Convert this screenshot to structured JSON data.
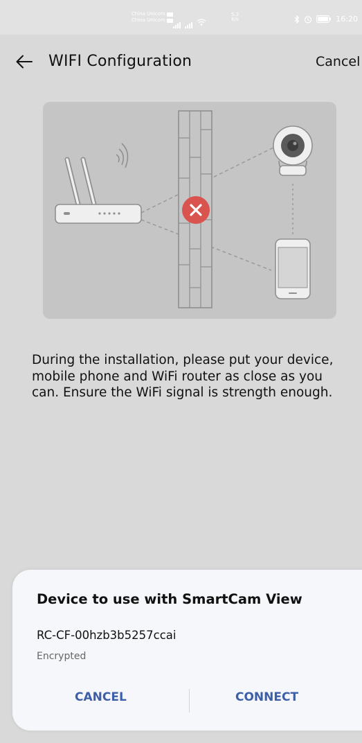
{
  "status_bar": {
    "carrier_1": "China Unicom",
    "carrier_2": "China Unicom",
    "net_speed_value": "5.3",
    "net_speed_unit": "K/s",
    "time": "16:20",
    "icons": [
      "signal-icon",
      "wifi-icon",
      "bluetooth-icon",
      "alarm-icon",
      "battery-icon"
    ]
  },
  "header": {
    "title": "WIFI Configuration",
    "cancel_label": "Cancel",
    "back_icon": "arrow-left-icon"
  },
  "illustration": {
    "icons": [
      "router-icon",
      "brick-wall-icon",
      "blocked-x-icon",
      "camera-icon",
      "phone-icon"
    ],
    "blocked_color": "#d9534f"
  },
  "instruction": {
    "text": "During the installation, please put your device, mobile phone and WiFi router as close as you can. Ensure the WiFi signal is strength enough."
  },
  "dialog": {
    "title": "Device to use with SmartCam View",
    "device_name": "RC-CF-00hzb3b5257ccai",
    "device_status": "Encrypted",
    "cancel_label": "CANCEL",
    "connect_label": "CONNECT",
    "accent_color": "#3c5fa8"
  }
}
